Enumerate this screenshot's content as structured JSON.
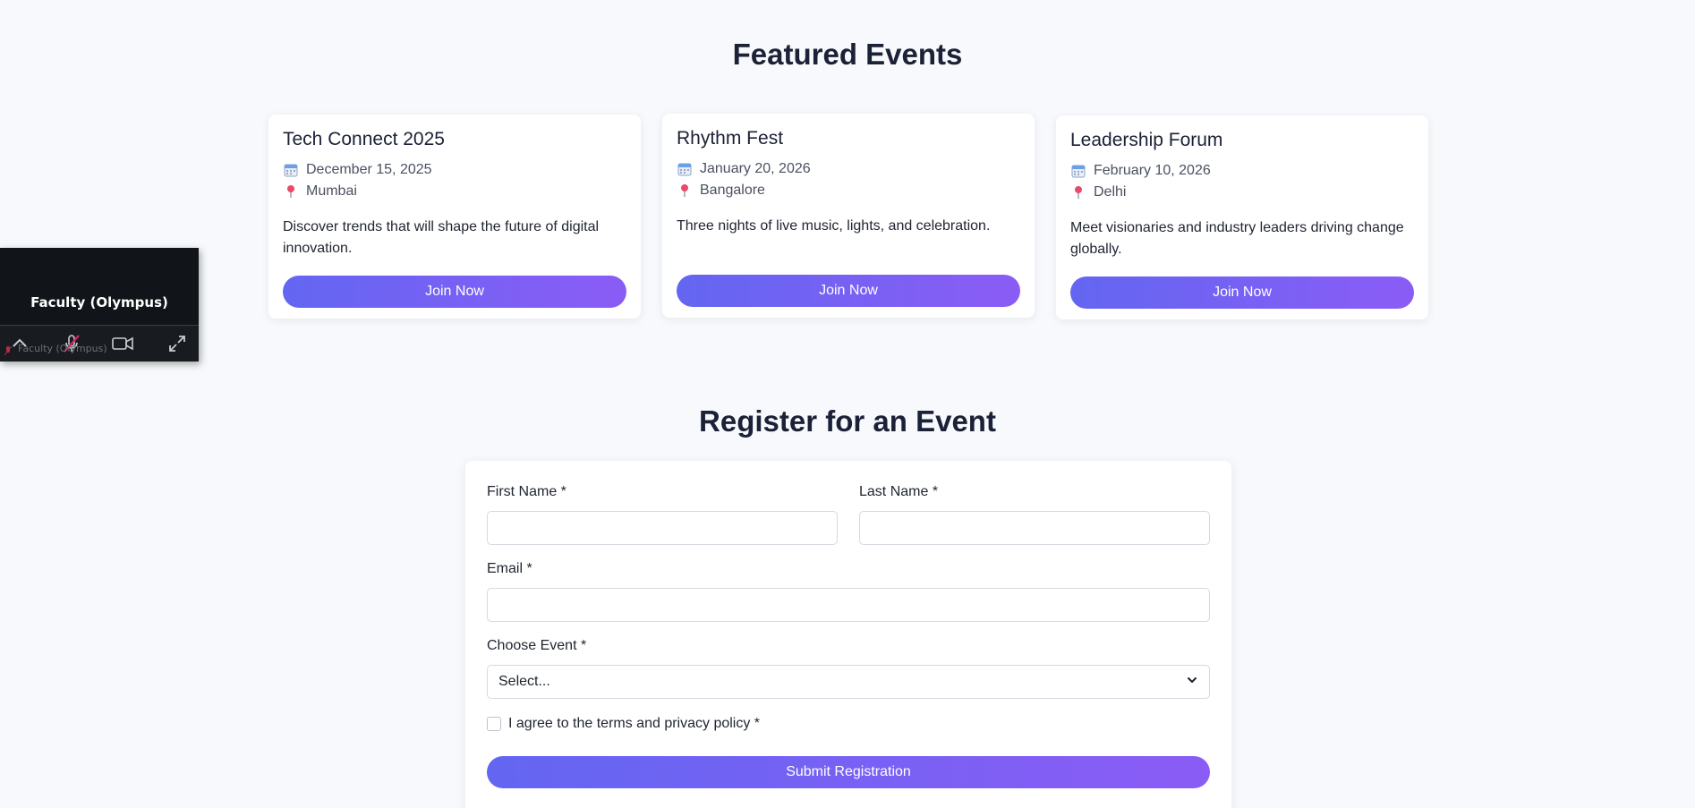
{
  "featured": {
    "title": "Featured Events",
    "events": [
      {
        "title": "Tech Connect 2025",
        "date": "December 15, 2025",
        "location": "Mumbai",
        "description": "Discover trends that will shape the future of digital innovation.",
        "button": "Join Now"
      },
      {
        "title": "Rhythm Fest",
        "date": "January 20, 2026",
        "location": "Bangalore",
        "description": "Three nights of live music, lights, and celebration.",
        "button": "Join Now"
      },
      {
        "title": "Leadership Forum",
        "date": "February 10, 2026",
        "location": "Delhi",
        "description": "Meet visionaries and industry leaders driving change globally.",
        "button": "Join Now"
      }
    ]
  },
  "register": {
    "title": "Register for an Event",
    "first_name_label": "First Name *",
    "last_name_label": "Last Name *",
    "email_label": "Email *",
    "choose_event_label": "Choose Event *",
    "choose_event_value": "Select...",
    "agree_label": "I agree to the terms and privacy policy *",
    "submit": "Submit Registration"
  },
  "video_tile": {
    "name": "Faculty (Olympus)",
    "overlay_name": "Faculty (Olympus)"
  },
  "icons": {
    "calendar": "calendar-icon",
    "location": "pin-icon",
    "chevron": "chevron-down-icon"
  },
  "colors": {
    "accent_start": "#6366f1",
    "accent_end": "#8b5cf6",
    "background": "#f7f9fc"
  }
}
